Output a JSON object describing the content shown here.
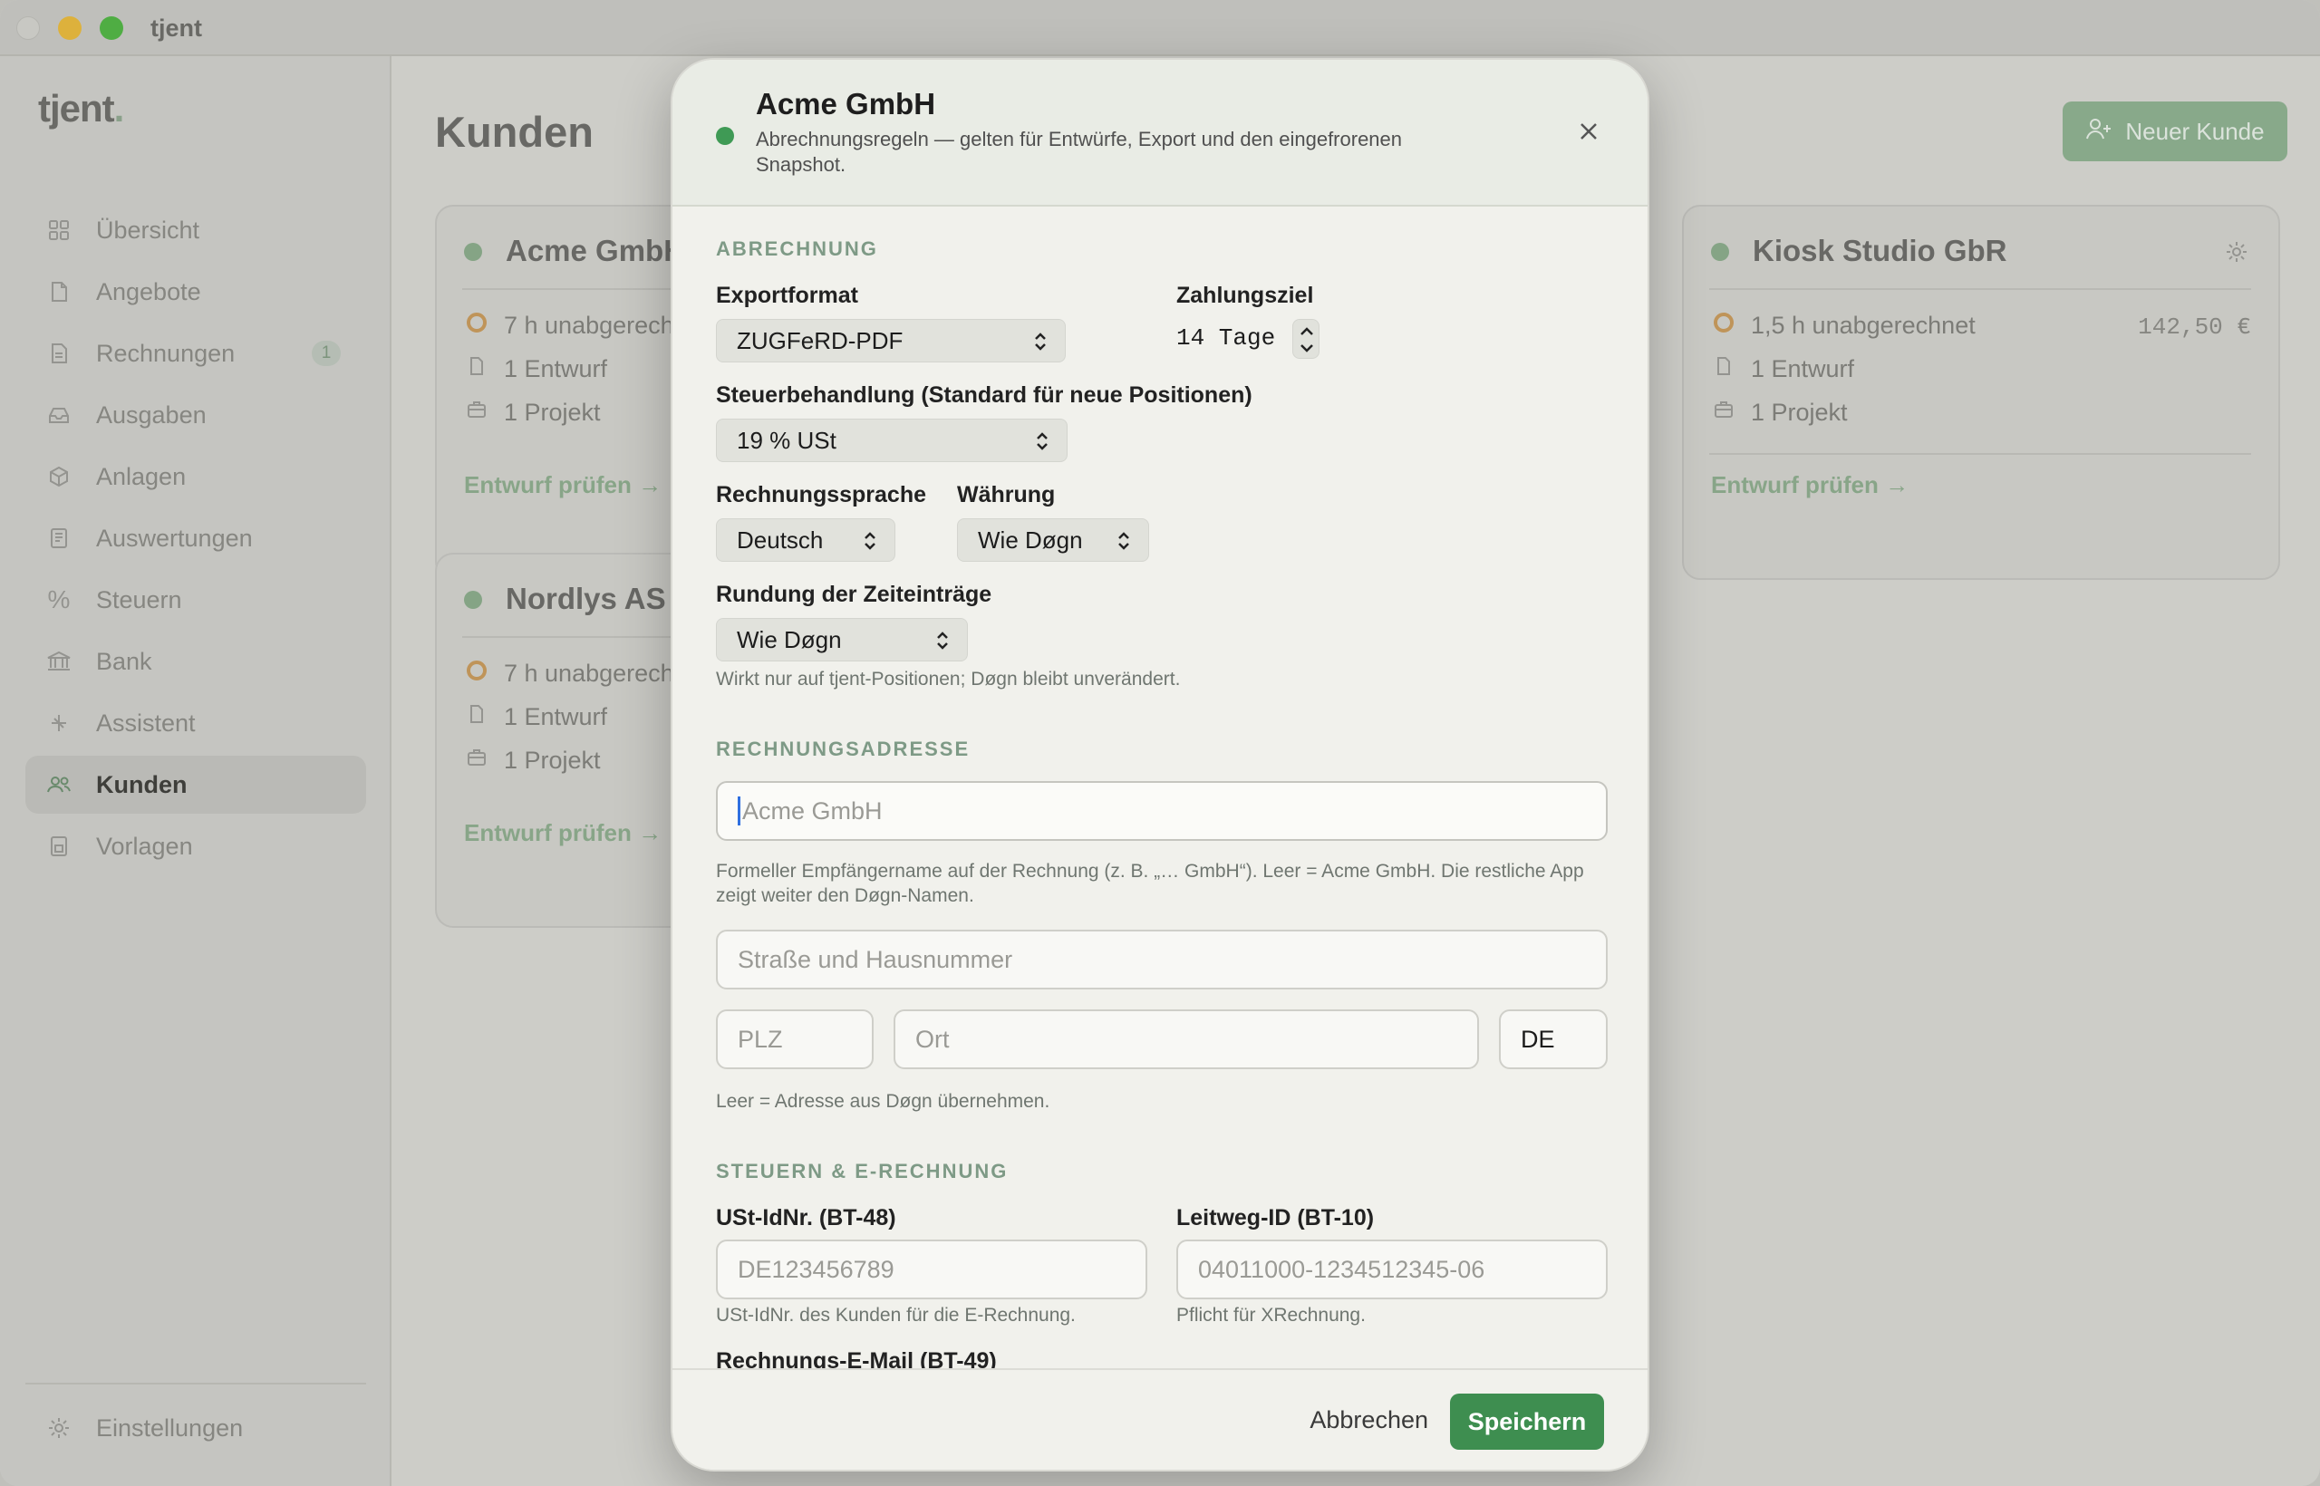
{
  "window": {
    "title": "tjent"
  },
  "sidebar": {
    "logo": "tjent",
    "items": [
      {
        "label": "Übersicht",
        "icon": "grid-icon"
      },
      {
        "label": "Angebote",
        "icon": "document-icon"
      },
      {
        "label": "Rechnungen",
        "icon": "invoice-icon",
        "badge": "1"
      },
      {
        "label": "Ausgaben",
        "icon": "inbox-icon"
      },
      {
        "label": "Anlagen",
        "icon": "box-icon"
      },
      {
        "label": "Auswertungen",
        "icon": "report-icon"
      },
      {
        "label": "Steuern",
        "icon": "percent-icon"
      },
      {
        "label": "Bank",
        "icon": "bank-icon"
      },
      {
        "label": "Assistent",
        "icon": "sparkle-icon"
      },
      {
        "label": "Kunden",
        "icon": "people-icon",
        "active": true
      },
      {
        "label": "Vorlagen",
        "icon": "template-icon"
      }
    ],
    "settings": "Einstellungen"
  },
  "main": {
    "title": "Kunden",
    "new_button": "Neuer Kunde",
    "cards": [
      {
        "name": "Acme GmbH",
        "unbilled": "7 h unabgerechnet",
        "drafts": "1 Entwurf",
        "projects": "1 Projekt",
        "link": "Entwurf prüfen →"
      },
      {
        "name": "Nordlys AS",
        "unbilled": "7 h unabgerechnet",
        "drafts": "1 Entwurf",
        "projects": "1 Projekt",
        "link": "Entwurf prüfen →"
      },
      {
        "name": "Kiosk Studio GbR",
        "unbilled": "1,5 h unabgerechnet",
        "amount": "142,50 €",
        "drafts": "1 Entwurf",
        "projects": "1 Projekt",
        "link": "Entwurf prüfen →"
      }
    ]
  },
  "modal": {
    "title": "Acme GmbH",
    "subtitle": "Abrechnungsregeln — gelten für Entwürfe, Export und den eingefrorenen Snapshot.",
    "sections": {
      "billing": "ABRECHNUNG",
      "address": "RECHNUNGSADRESSE",
      "tax": "STEUERN & E-RECHNUNG"
    },
    "export_format": {
      "label": "Exportformat",
      "value": "ZUGFeRD-PDF"
    },
    "payment_terms": {
      "label": "Zahlungsziel",
      "value": "14 Tage"
    },
    "tax_treatment": {
      "label": "Steuerbehandlung (Standard für neue Positionen)",
      "value": "19 % USt"
    },
    "language": {
      "label": "Rechnungssprache",
      "value": "Deutsch"
    },
    "currency": {
      "label": "Währung",
      "value": "Wie Døgn"
    },
    "rounding": {
      "label": "Rundung der Zeiteinträge",
      "value": "Wie Døgn",
      "hint": "Wirkt nur auf tjent-Positionen; Døgn bleibt unverändert."
    },
    "recipient": {
      "placeholder": "Acme GmbH",
      "hint": "Formeller Empfängername auf der Rechnung (z. B. „… GmbH“). Leer = Acme GmbH. Die restliche App zeigt weiter den Døgn-Namen."
    },
    "street": {
      "placeholder": "Straße und Hausnummer"
    },
    "zip": {
      "placeholder": "PLZ"
    },
    "city": {
      "placeholder": "Ort"
    },
    "country": {
      "value": "DE"
    },
    "address_hint": "Leer = Adresse aus Døgn übernehmen.",
    "vat_id": {
      "label": "USt-IdNr. (BT-48)",
      "placeholder": "DE123456789",
      "hint": "USt-IdNr. des Kunden für die E-Rechnung."
    },
    "leitweg": {
      "label": "Leitweg-ID (BT-10)",
      "placeholder": "04011000-1234512345-06",
      "hint": "Pflicht für XRechnung."
    },
    "email": {
      "label": "Rechnungs-E-Mail (BT-49)"
    },
    "cancel": "Abbrechen",
    "save": "Speichern"
  },
  "colors": {
    "accent": "#3e8e50",
    "status_dot": "#3f9a55",
    "section": "#7e9a86"
  }
}
